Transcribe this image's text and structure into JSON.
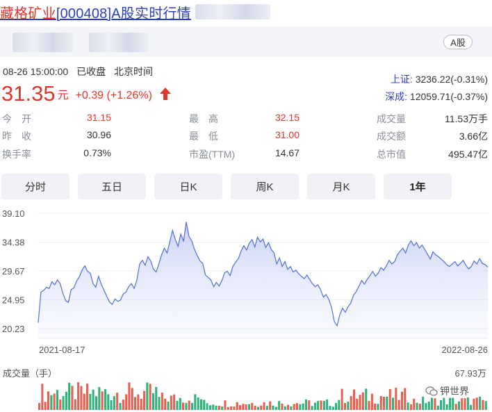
{
  "header": {
    "stock_name": "藏格矿业",
    "stock_code": "[000408]",
    "title_suffix": "A股实时行情",
    "market_badge": "A股"
  },
  "quote": {
    "date_time": "08-26 15:00:00",
    "status": "已收盘",
    "timezone": "北京时间",
    "price": "31.35",
    "unit": "元",
    "change": "+0.39 (+1.26%)",
    "direction": "up-arrow-icon"
  },
  "indices": [
    {
      "label": "上证:",
      "value": "3236.22(-0.31%)"
    },
    {
      "label": "深成:",
      "value": "12059.71(-0.37%)"
    }
  ],
  "stats": {
    "open_label": "今　开",
    "open_value": "31.15",
    "prev_close_label": "昨　收",
    "prev_close_value": "30.96",
    "turnover_rate_label": "换手率",
    "turnover_rate_value": "0.73%",
    "high_label": "最　高",
    "high_value": "32.15",
    "low_label": "最　低",
    "low_value": "31.00",
    "pe_label": "市盈(TTM)",
    "pe_value": "14.67",
    "volume_label": "成交量",
    "volume_value": "11.53万手",
    "amount_label": "成交额",
    "amount_value": "3.66亿",
    "market_cap_label": "总市值",
    "market_cap_value": "495.47亿"
  },
  "tabs": [
    "分时",
    "五日",
    "日K",
    "周K",
    "月K",
    "1年"
  ],
  "active_tab": "1年",
  "chart": {
    "y_ticks": [
      "39.10",
      "34.38",
      "29.67",
      "24.95",
      "20.23"
    ],
    "x_start": "2021-08-17",
    "x_end": "2022-08-26",
    "volume_label": "成交量（手）",
    "volume_max": "67.93万"
  },
  "chart_data": {
    "type": "area",
    "x_range": [
      "2021-08-17",
      "2022-08-26"
    ],
    "ylim": [
      20.23,
      39.1
    ],
    "series": [
      {
        "values": [
          21.2,
          26.2,
          26.5,
          27.0,
          26.8,
          27.9,
          27.4,
          28.2,
          27.6,
          26.0,
          24.8,
          24.5,
          26.6,
          26.9,
          28.0,
          28.7,
          29.8,
          30.5,
          29.6,
          29.3,
          27.6,
          27.0,
          28.8,
          27.5,
          26.5,
          25.5,
          24.6,
          24.2,
          25.1,
          24.7,
          24.9,
          25.9,
          26.2,
          27.1,
          27.6,
          26.8,
          28.2,
          30.8,
          31.4,
          30.6,
          32.0,
          31.3,
          30.0,
          29.5,
          30.8,
          32.3,
          33.4,
          32.6,
          34.5,
          36.3,
          34.8,
          33.7,
          35.7,
          34.5,
          37.7,
          35.3,
          34.6,
          33.2,
          32.2,
          31.3,
          30.9,
          29.0,
          28.6,
          28.2,
          27.1,
          27.8,
          27.2,
          28.1,
          29.4,
          29.6,
          28.9,
          30.4,
          31.1,
          31.7,
          32.9,
          33.8,
          33.1,
          34.2,
          34.8,
          33.6,
          35.2,
          34.4,
          34.9,
          33.5,
          34.3,
          33.2,
          32.6,
          30.8,
          31.8,
          30.4,
          31.2,
          29.9,
          30.4,
          29.5,
          29.8,
          29.2,
          28.8,
          28.4,
          29.0,
          28.3,
          27.6,
          27.1,
          27.4,
          26.6,
          25.4,
          25.8,
          25.0,
          23.7,
          21.4,
          20.7,
          22.5,
          23.6,
          22.9,
          23.8,
          24.4,
          25.7,
          26.3,
          27.2,
          28.1,
          27.5,
          28.3,
          28.9,
          29.6,
          28.8,
          29.3,
          30.2,
          29.8,
          30.5,
          31.4,
          30.8,
          31.2,
          32.3,
          32.9,
          33.4,
          32.6,
          33.9,
          34.6,
          33.8,
          34.3,
          33.4,
          33.9,
          33.2,
          32.4,
          31.6,
          32.8,
          32.3,
          32.0,
          31.6,
          31.2,
          30.7,
          30.4,
          30.8,
          31.2,
          30.5,
          30.9,
          31.4,
          30.6,
          30.0,
          30.4,
          31.3,
          30.8,
          31.7,
          30.9,
          30.7,
          30.3
        ]
      }
    ],
    "grid": true
  }
}
